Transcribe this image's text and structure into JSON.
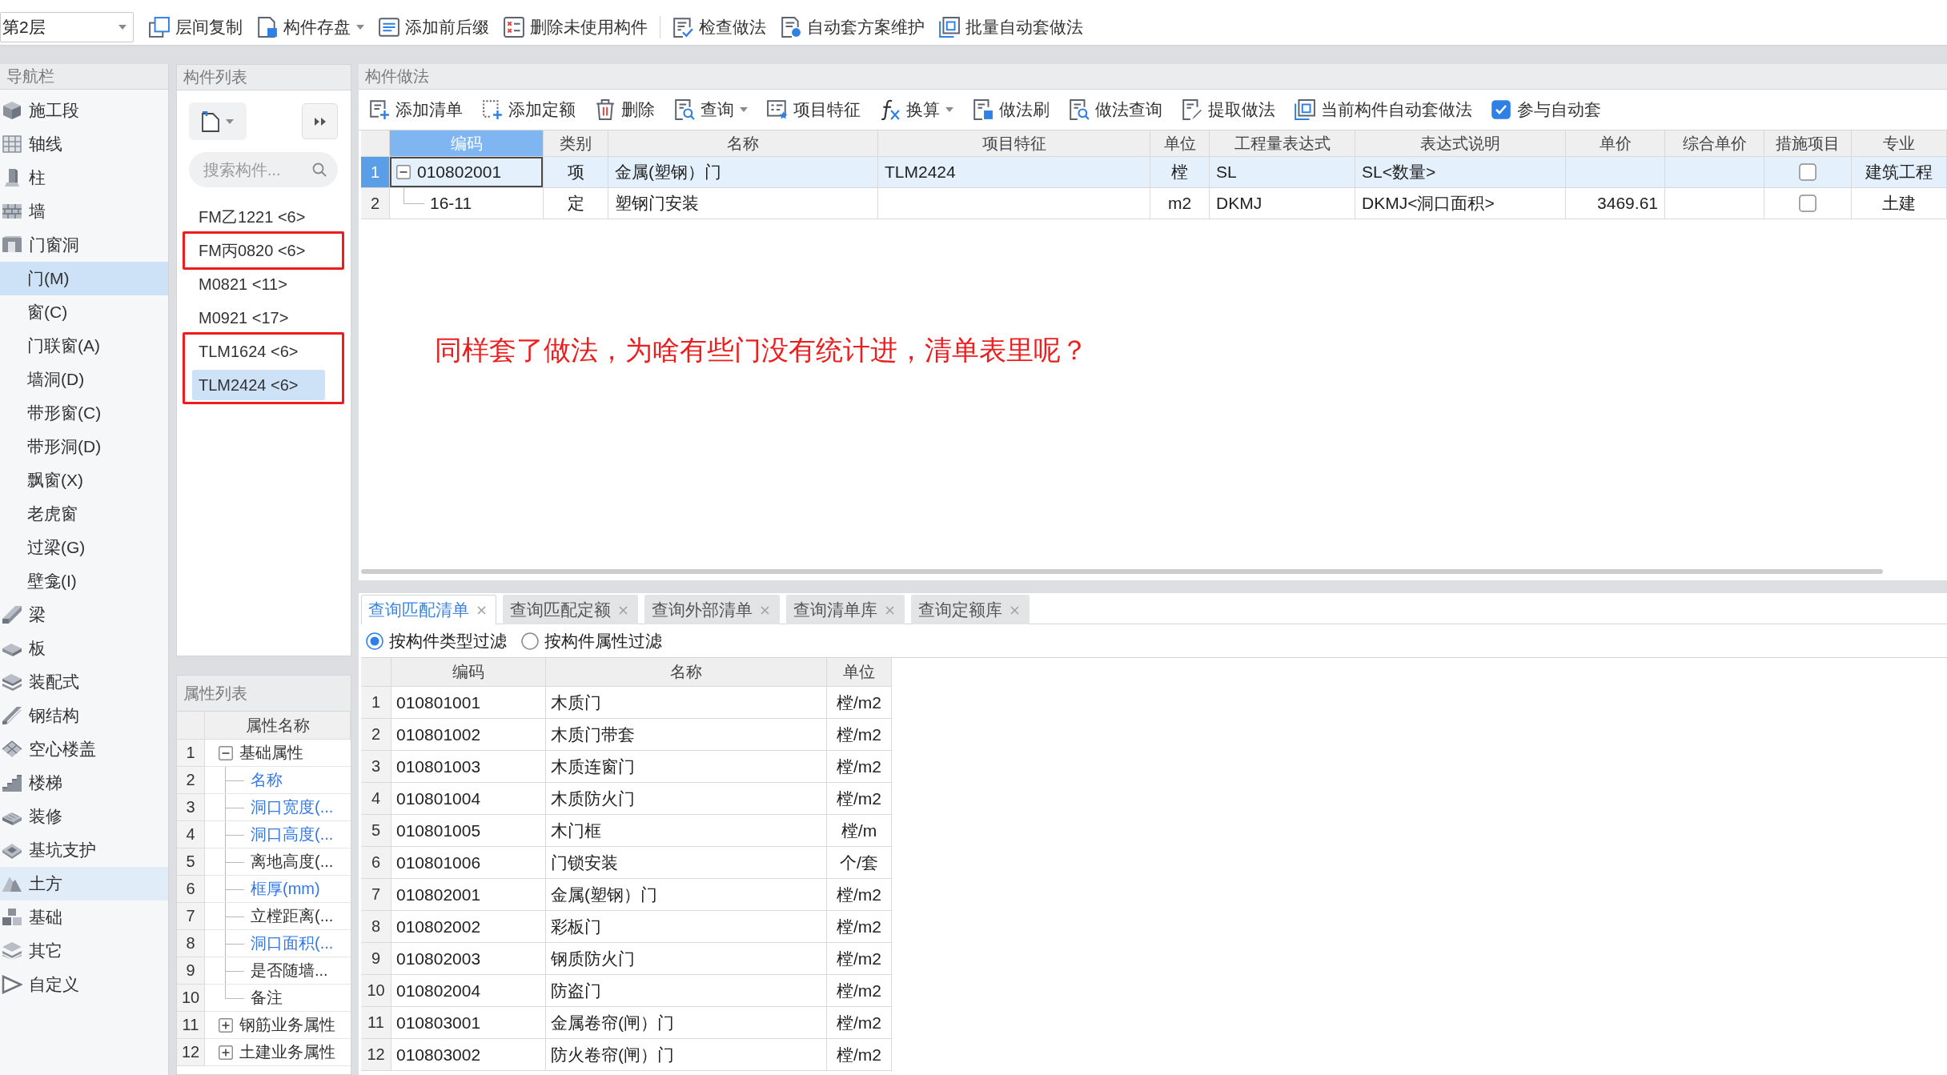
{
  "toolbar": {
    "floor_select": {
      "value": "第2层"
    },
    "groups": [
      [
        {
          "label": "层间复制",
          "dropdown": false
        },
        {
          "label": "构件存盘",
          "dropdown": true
        },
        {
          "label": "添加前后缀",
          "dropdown": false
        },
        {
          "label": "删除未使用构件",
          "dropdown": false
        }
      ],
      [
        {
          "label": "检查做法",
          "dropdown": false
        },
        {
          "label": "自动套方案维护",
          "dropdown": false
        },
        {
          "label": "批量自动套做法",
          "dropdown": false
        }
      ]
    ]
  },
  "nav": {
    "title": "导航栏",
    "items": [
      {
        "label": "施工段",
        "selected": false,
        "hovered": false
      },
      {
        "label": "轴线",
        "selected": false,
        "hovered": false
      },
      {
        "label": "柱",
        "selected": false,
        "hovered": false
      },
      {
        "label": "墙",
        "selected": false,
        "hovered": false
      },
      {
        "label": "门窗洞",
        "selected": false,
        "hovered": false,
        "children": [
          {
            "label": "门(M)",
            "selected": true,
            "hovered": false
          },
          {
            "label": "窗(C)",
            "selected": false,
            "hovered": false
          },
          {
            "label": "门联窗(A)",
            "selected": false,
            "hovered": false
          },
          {
            "label": "墙洞(D)",
            "selected": false,
            "hovered": false
          },
          {
            "label": "带形窗(C)",
            "selected": false,
            "hovered": false
          },
          {
            "label": "带形洞(D)",
            "selected": false,
            "hovered": false
          },
          {
            "label": "飘窗(X)",
            "selected": false,
            "hovered": false
          },
          {
            "label": "老虎窗",
            "selected": false,
            "hovered": false
          },
          {
            "label": "过梁(G)",
            "selected": false,
            "hovered": false
          },
          {
            "label": "壁龛(I)",
            "selected": false,
            "hovered": false
          }
        ]
      },
      {
        "label": "梁",
        "selected": false,
        "hovered": false
      },
      {
        "label": "板",
        "selected": false,
        "hovered": false
      },
      {
        "label": "装配式",
        "selected": false,
        "hovered": false
      },
      {
        "label": "钢结构",
        "selected": false,
        "hovered": false
      },
      {
        "label": "空心楼盖",
        "selected": false,
        "hovered": false
      },
      {
        "label": "楼梯",
        "selected": false,
        "hovered": false
      },
      {
        "label": "装修",
        "selected": false,
        "hovered": false
      },
      {
        "label": "基坑支护",
        "selected": false,
        "hovered": false
      },
      {
        "label": "土方",
        "selected": false,
        "hovered": true
      },
      {
        "label": "基础",
        "selected": false,
        "hovered": false
      },
      {
        "label": "其它",
        "selected": false,
        "hovered": false
      },
      {
        "label": "自定义",
        "selected": false,
        "hovered": false
      }
    ]
  },
  "component_list": {
    "title": "构件列表",
    "search": {
      "placeholder": "搜索构件..."
    },
    "items": [
      {
        "label": "FM乙1221 <6>",
        "selected": false,
        "boxed": false
      },
      {
        "label": "FM丙0820 <6>",
        "selected": false,
        "boxed": true
      },
      {
        "label": "M0821 <11>",
        "selected": false,
        "boxed": false
      },
      {
        "label": "M0921 <17>",
        "selected": false,
        "boxed": false
      },
      {
        "label": "TLM1624 <6>",
        "selected": false,
        "boxed": true
      },
      {
        "label": "TLM2424 <6>",
        "selected": true,
        "boxed": true
      }
    ]
  },
  "properties": {
    "title": "属性列表",
    "column": "属性名称",
    "rows": [
      {
        "kind": "group",
        "num": "1",
        "label": "基础属性",
        "expanded": true,
        "children": [
          {
            "kind": "field",
            "num": "2",
            "label": "名称",
            "color": "#3478e5"
          },
          {
            "kind": "field",
            "num": "3",
            "label": "洞口宽度(...",
            "color": "#3478e5"
          },
          {
            "kind": "field",
            "num": "4",
            "label": "洞口高度(...",
            "color": "#3478e5"
          },
          {
            "kind": "field",
            "num": "5",
            "label": "离地高度(...",
            "color": "#333333"
          },
          {
            "kind": "field",
            "num": "6",
            "label": "框厚(mm)",
            "color": "#3478e5"
          },
          {
            "kind": "field",
            "num": "7",
            "label": "立樘距离(...",
            "color": "#333333"
          },
          {
            "kind": "field",
            "num": "8",
            "label": "洞口面积(...",
            "color": "#3478e5"
          },
          {
            "kind": "field",
            "num": "9",
            "label": "是否随墙...",
            "color": "#333333"
          },
          {
            "kind": "field",
            "num": "10",
            "label": "备注",
            "color": "#333333"
          }
        ]
      },
      {
        "kind": "group",
        "num": "11",
        "label": "钢筋业务属性",
        "expanded": false
      },
      {
        "kind": "group",
        "num": "12",
        "label": "土建业务属性",
        "expanded": false
      }
    ]
  },
  "method": {
    "title": "构件做法",
    "toolbar": [
      {
        "kind": "button",
        "label": "添加清单",
        "dropdown": false
      },
      {
        "kind": "button",
        "label": "添加定额",
        "dropdown": false
      },
      {
        "kind": "button",
        "label": "删除",
        "dropdown": false
      },
      {
        "kind": "button",
        "label": "查询",
        "dropdown": true
      },
      {
        "kind": "button",
        "label": "项目特征",
        "dropdown": false
      },
      {
        "kind": "button",
        "label": "换算",
        "dropdown": true
      },
      {
        "kind": "button",
        "label": "做法刷",
        "dropdown": false
      },
      {
        "kind": "button",
        "label": "做法查询",
        "dropdown": false
      },
      {
        "kind": "button",
        "label": "提取做法",
        "dropdown": false
      },
      {
        "kind": "button",
        "label": "当前构件自动套做法",
        "dropdown": false
      },
      {
        "kind": "checkbox",
        "label": "参与自动套",
        "checked": true
      }
    ],
    "table": {
      "columns": [
        {
          "label": "编码",
          "selected": true
        },
        {
          "label": "类别",
          "selected": false
        },
        {
          "label": "名称",
          "selected": false
        },
        {
          "label": "项目特征",
          "selected": false
        },
        {
          "label": "单位",
          "selected": false
        },
        {
          "label": "工程量表达式",
          "selected": false
        },
        {
          "label": "表达式说明",
          "selected": false
        },
        {
          "label": "单价",
          "selected": false
        },
        {
          "label": "综合单价",
          "selected": false
        },
        {
          "label": "措施项目",
          "selected": false
        },
        {
          "label": "专业",
          "selected": false
        }
      ],
      "rows": [
        {
          "num": "1",
          "selected": true,
          "expanded": true,
          "code": "010802001",
          "category": "项",
          "name": "金属(塑钢）门",
          "feature": "TLM2424",
          "unit": "樘",
          "expression": "SL",
          "expression_note": "SL<数量>",
          "measure": false,
          "discipline": "建筑工程",
          "children": [
            {
              "num": "2",
              "selected": false,
              "code": "16-11",
              "category": "定",
              "name": "塑钢门安装",
              "unit": "m2",
              "expression": "DKMJ",
              "expression_note": "DKMJ<洞口面积>",
              "price": "3469.61",
              "measure": false,
              "discipline": "土建"
            }
          ]
        }
      ]
    }
  },
  "annotation": {
    "text": "同样套了做法，为啥有些门没有统计进，清单表里呢？"
  },
  "query": {
    "tabs": [
      {
        "label": "查询匹配清单",
        "selected": true
      },
      {
        "label": "查询匹配定额",
        "selected": false
      },
      {
        "label": "查询外部清单",
        "selected": false
      },
      {
        "label": "查询清单库",
        "selected": false
      },
      {
        "label": "查询定额库",
        "selected": false
      }
    ],
    "filters": [
      {
        "label": "按构件类型过滤",
        "selected": true
      },
      {
        "label": "按构件属性过滤",
        "selected": false
      }
    ],
    "table": {
      "columns": [
        "编码",
        "名称",
        "单位"
      ],
      "rows": [
        {
          "num": "1",
          "code": "010801001",
          "name": "木质门",
          "unit": "樘/m2"
        },
        {
          "num": "2",
          "code": "010801002",
          "name": "木质门带套",
          "unit": "樘/m2"
        },
        {
          "num": "3",
          "code": "010801003",
          "name": "木质连窗门",
          "unit": "樘/m2"
        },
        {
          "num": "4",
          "code": "010801004",
          "name": "木质防火门",
          "unit": "樘/m2"
        },
        {
          "num": "5",
          "code": "010801005",
          "name": "木门框",
          "unit": "樘/m"
        },
        {
          "num": "6",
          "code": "010801006",
          "name": "门锁安装",
          "unit": "个/套"
        },
        {
          "num": "7",
          "code": "010802001",
          "name": "金属(塑钢）门",
          "unit": "樘/m2"
        },
        {
          "num": "8",
          "code": "010802002",
          "name": "彩板门",
          "unit": "樘/m2"
        },
        {
          "num": "9",
          "code": "010802003",
          "name": "钢质防火门",
          "unit": "樘/m2"
        },
        {
          "num": "10",
          "code": "010802004",
          "name": "防盗门",
          "unit": "樘/m2"
        },
        {
          "num": "11",
          "code": "010803001",
          "name": "金属卷帘(闸）门",
          "unit": "樘/m2"
        },
        {
          "num": "12",
          "code": "010803002",
          "name": "防火卷帘(闸）门",
          "unit": "樘/m2"
        }
      ]
    }
  }
}
